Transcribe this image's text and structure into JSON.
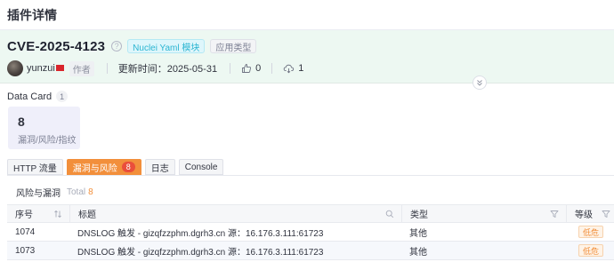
{
  "page": {
    "title": "插件详情"
  },
  "plugin": {
    "name": "CVE-2025-4123",
    "help_icon": "question-circle-icon",
    "tags": [
      "Nuclei Yaml 模块",
      "应用类型"
    ],
    "author": "yunzui",
    "author_flag": "flag-icon",
    "author_tag": "作者",
    "updated_label": "更新时间：",
    "updated_value": "2025-05-31",
    "likes": "0",
    "downloads": "1",
    "collapse_icon": "double-chevron-down-icon"
  },
  "data_card": {
    "title": "Data Card",
    "count": "1",
    "cards": [
      {
        "value": "8",
        "label": "漏洞/风险/指纹"
      }
    ]
  },
  "tabs": [
    {
      "label": "HTTP 流量",
      "active": false
    },
    {
      "label": "漏洞与风险",
      "badge": "8",
      "active": true
    },
    {
      "label": "日志",
      "active": false
    },
    {
      "label": "Console",
      "active": false
    }
  ],
  "risk_section": {
    "title": "风险与漏洞",
    "total_label": "Total",
    "total_value": "8"
  },
  "table": {
    "columns": [
      "序号",
      "标题",
      "类型",
      "等级"
    ],
    "rows": [
      {
        "id": "1074",
        "title": "DNSLOG 触发 - gizqfzzphm.dgrh3.cn 源：16.176.3.111:61723",
        "type": "其他",
        "level": "低危"
      },
      {
        "id": "1073",
        "title": "DNSLOG 触发 - gizqfzzphm.dgrh3.cn 源：16.176.3.111:61723",
        "type": "其他",
        "level": "低危"
      }
    ]
  },
  "colors": {
    "accent_orange": "#f28f3b",
    "badge_red": "#ea4e3b",
    "hero_bg": "#edf8f2",
    "tag_cyan": "#2bb5d2",
    "card_bg": "#efeffa"
  }
}
